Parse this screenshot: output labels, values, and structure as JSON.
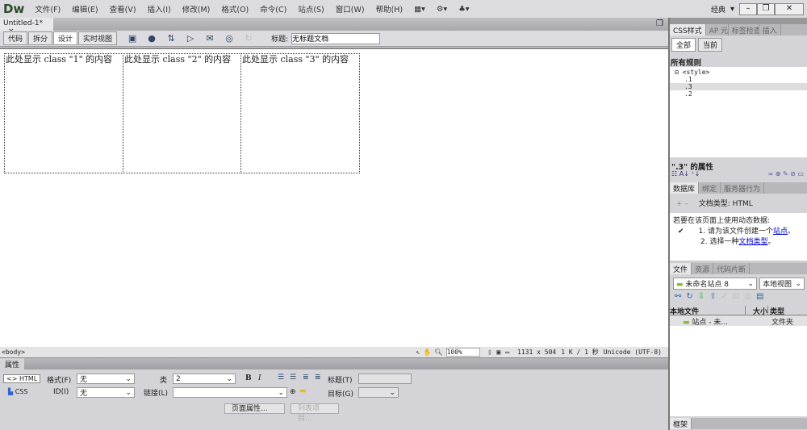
{
  "app": {
    "logo": "Dw",
    "menus": [
      "文件(F)",
      "编辑(E)",
      "查看(V)",
      "插入(I)",
      "修改(M)",
      "格式(O)",
      "命令(C)",
      "站点(S)",
      "窗口(W)",
      "帮助(H)"
    ],
    "workspace": "经典"
  },
  "document": {
    "tab": "Untitled-1*",
    "close": "×"
  },
  "toolbar": {
    "views": [
      "代码",
      "拆分",
      "设计",
      "实时视图"
    ],
    "active_view": "设计",
    "title_label": "标题:",
    "title_value": "无标题文档"
  },
  "design": {
    "boxes": [
      "此处显示 class \"1\" 的内容",
      "此处显示 class \"2\" 的内容",
      "此处显示 class \"3\" 的内容"
    ]
  },
  "status": {
    "tag": "<body>",
    "zoom": "100%",
    "size": "1131 x 504",
    "download": "1 K / 1 秒",
    "encoding": "Unicode (UTF-8)"
  },
  "properties": {
    "tab": "属性",
    "html": "<> HTML",
    "css": "CSS",
    "format_label": "格式(F)",
    "format_value": "无",
    "id_label": "ID(I)",
    "id_value": "无",
    "class_label": "类",
    "class_value": "2",
    "link_label": "链接(L)",
    "link_value": "",
    "bold": "B",
    "italic": "I",
    "title_label": "标题(T)",
    "target_label": "目标(G)",
    "page_props": "页面属性...",
    "list_item": "列表项目..."
  },
  "css_panel": {
    "tabs": [
      "CSS样式",
      "AP 元素",
      "标签检查器",
      "插入"
    ],
    "modes": [
      "全部",
      "当前"
    ],
    "all_rules": "所有规则",
    "tree": [
      "<style>",
      ".1",
      ".3",
      ".2"
    ],
    "selected_rule": ".3",
    "props_title": "\".3\" 的属性"
  },
  "data_panel": {
    "tabs": [
      "数据库",
      "绑定",
      "服务器行为"
    ],
    "doctype": "文档类型: HTML",
    "intro": "若要在该页面上使用动态数据:",
    "step1_prefix": "1. 请为该文件创建一个",
    "step1_link": "站点",
    "step2_prefix": "2. 选择一种",
    "step2_link": "文档类型",
    "check": "✔"
  },
  "files_panel": {
    "tabs": [
      "文件",
      "资源",
      "代码片断"
    ],
    "site": "未命名站点 8",
    "view": "本地视图",
    "columns": [
      "本地文件",
      "大小",
      "类型"
    ],
    "rows": [
      {
        "name": "站点 - 未...",
        "size": "",
        "type": "文件夹"
      }
    ]
  },
  "frames_panel": {
    "tab": "框架"
  }
}
